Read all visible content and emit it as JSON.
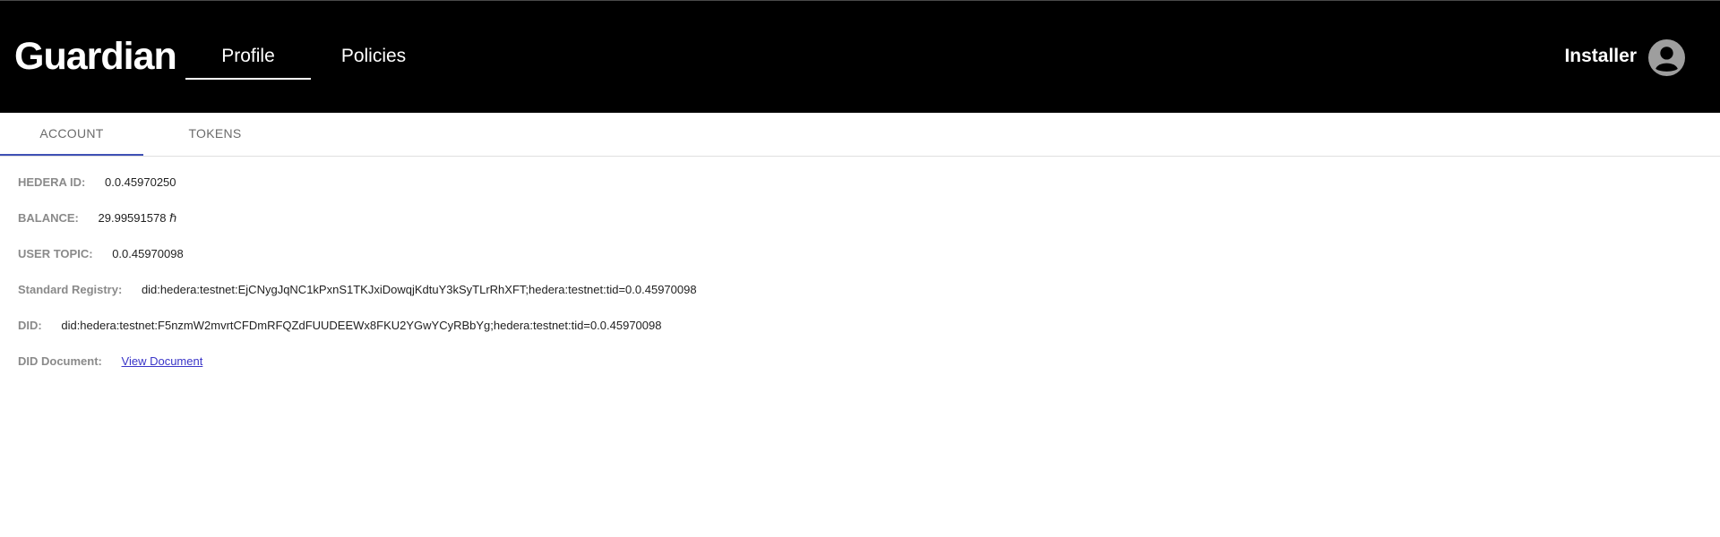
{
  "header": {
    "brand": "Guardian",
    "nav": [
      {
        "label": "Profile",
        "active": true
      },
      {
        "label": "Policies",
        "active": false
      }
    ],
    "user": {
      "name": "Installer",
      "avatar_icon": "account-circle-icon"
    },
    "background": "#000000"
  },
  "tabs": [
    {
      "label": "ACCOUNT",
      "active": true
    },
    {
      "label": "TOKENS",
      "active": false
    }
  ],
  "accent": "#3f51b5",
  "account": {
    "hedera_id": {
      "label": "HEDERA ID:",
      "value": "0.0.45970250"
    },
    "balance": {
      "label": "BALANCE:",
      "value": "29.99591578 ℏ"
    },
    "user_topic": {
      "label": "USER TOPIC:",
      "value": "0.0.45970098"
    },
    "standard_registry": {
      "label": "Standard Registry:",
      "value": "did:hedera:testnet:EjCNygJqNC1kPxnS1TKJxiDowqjKdtuY3kSyTLrRhXFT;hedera:testnet:tid=0.0.45970098"
    },
    "did": {
      "label": "DID:",
      "value": "did:hedera:testnet:F5nzmW2mvrtCFDmRFQZdFUUDEEWx8FKU2YGwYCyRBbYg;hedera:testnet:tid=0.0.45970098"
    },
    "did_document": {
      "label": "DID Document:",
      "link": "View Document"
    }
  }
}
